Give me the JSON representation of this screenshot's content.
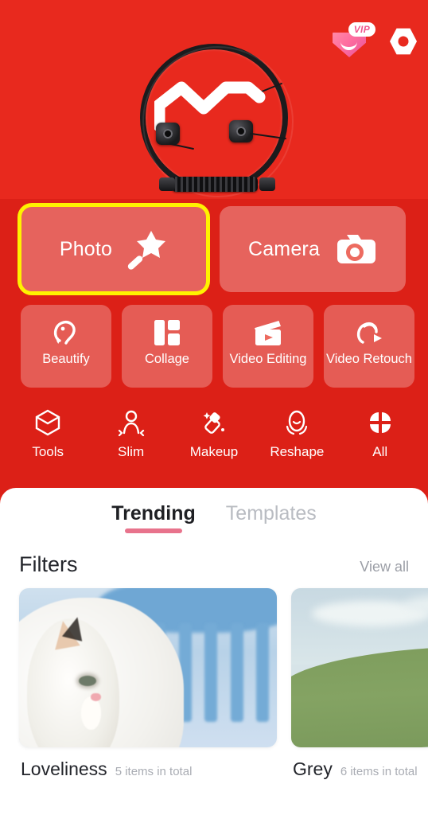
{
  "topbar": {
    "vip": {
      "label": "VIP",
      "icon": "vip-diamond-icon",
      "color": "#F0568E"
    },
    "settings": {
      "icon": "gear-icon"
    }
  },
  "hero": {
    "description": "Black cable loop with white zigzag tube product photo on red background",
    "background_color": "#E8291E"
  },
  "primary_actions": [
    {
      "label": "Photo",
      "icon": "magic-wand-icon",
      "selected": true,
      "highlight_color": "#FFF200"
    },
    {
      "label": "Camera",
      "icon": "camera-icon",
      "selected": false,
      "highlight_color": ""
    }
  ],
  "secondary_actions": [
    {
      "label": "Beautify",
      "icon": "beautify-face-icon"
    },
    {
      "label": "Collage",
      "icon": "collage-grid-icon"
    },
    {
      "label": "Video Editing",
      "icon": "clapperboard-play-icon"
    },
    {
      "label": "Video Retouch",
      "icon": "face-play-icon"
    }
  ],
  "nav_items": [
    {
      "label": "Tools",
      "icon": "hexagon-box-icon"
    },
    {
      "label": "Slim",
      "icon": "person-slim-icon"
    },
    {
      "label": "Makeup",
      "icon": "lipstick-sparkle-icon"
    },
    {
      "label": "Reshape",
      "icon": "face-reshape-icon"
    },
    {
      "label": "All",
      "icon": "grid-clover-icon"
    }
  ],
  "tabs": [
    {
      "label": "Trending",
      "active": true
    },
    {
      "label": "Templates",
      "active": false
    }
  ],
  "tab_underline_color": "#E8738C",
  "section": {
    "title": "Filters",
    "view_all": "View all"
  },
  "filter_cards": [
    {
      "name": "Loveliness",
      "count": "5 items in total",
      "image": "white-cat-profile-blue-chair"
    },
    {
      "name": "Grey",
      "count": "6 items in total",
      "image": "woman-blue-dress-green-field"
    }
  ]
}
